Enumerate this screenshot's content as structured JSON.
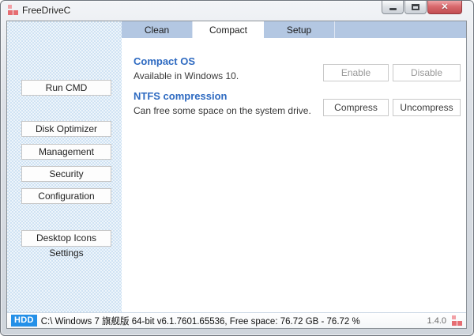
{
  "window": {
    "title": "FreeDriveC",
    "controls": {
      "close_glyph": "✕"
    }
  },
  "tabs": [
    {
      "label": "Clean",
      "active": false
    },
    {
      "label": "Compact",
      "active": true
    },
    {
      "label": "Setup",
      "active": false
    }
  ],
  "sidebar": {
    "buttons": [
      {
        "label": "Run CMD"
      },
      {
        "label": "Disk Optimizer"
      },
      {
        "label": "Management"
      },
      {
        "label": "Security"
      },
      {
        "label": "Configuration"
      },
      {
        "label": "Desktop Icons Settings"
      }
    ]
  },
  "content": {
    "sections": [
      {
        "title": "Compact OS",
        "description": "Available in Windows 10.",
        "buttons": [
          {
            "label": "Enable",
            "enabled": false
          },
          {
            "label": "Disable",
            "enabled": false
          }
        ]
      },
      {
        "title": "NTFS compression",
        "description": "Can free some space on the system drive.",
        "buttons": [
          {
            "label": "Compress",
            "enabled": true
          },
          {
            "label": "Uncompress",
            "enabled": true
          }
        ]
      }
    ]
  },
  "statusbar": {
    "drive_badge": "HDD",
    "info": "C:\\ Windows 7 旗舰版  64-bit v6.1.7601.65536, Free space: 76.72 GB - 76.72 %",
    "version": "1.4.0"
  },
  "colors": {
    "tabstrip": "#b3c7e2",
    "heading_blue": "#2e6ac1",
    "badge_blue": "#2490e8",
    "close_red": "#c24d52",
    "logo_pink": "#f2a0a6",
    "logo_red": "#e66d72"
  }
}
